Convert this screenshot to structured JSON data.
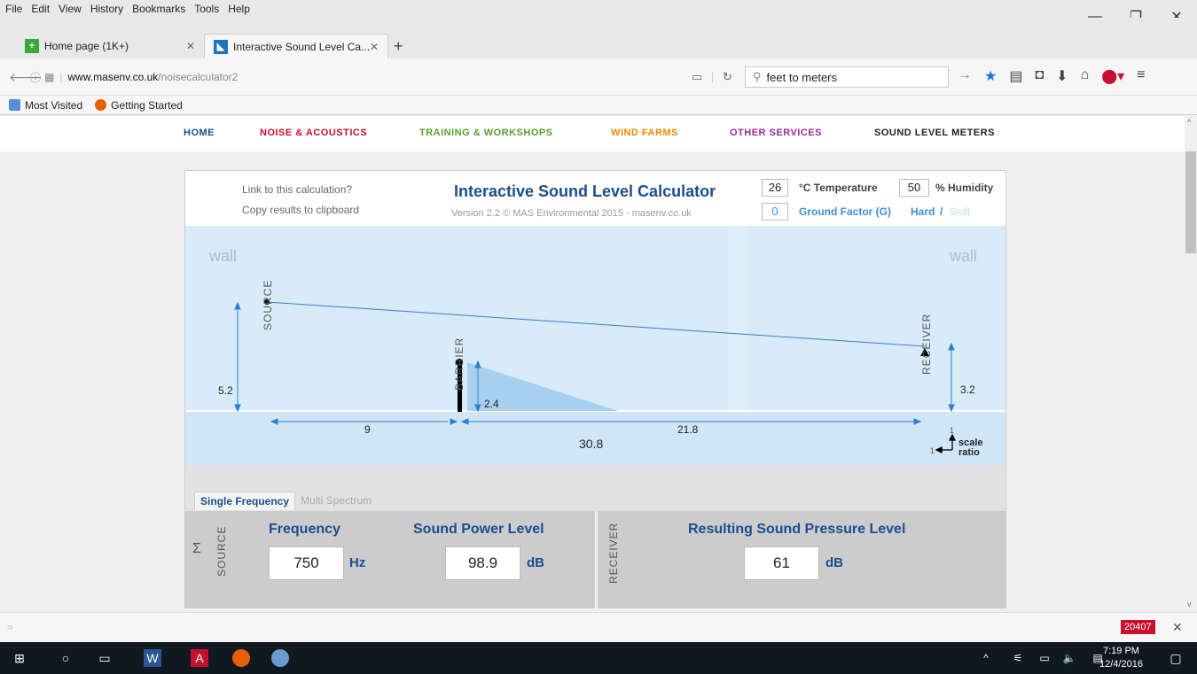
{
  "menubar": [
    "File",
    "Edit",
    "View",
    "History",
    "Bookmarks",
    "Tools",
    "Help"
  ],
  "tabs": [
    {
      "title": "Home page (1K+)",
      "active": false
    },
    {
      "title": "Interactive Sound Level Ca...",
      "active": true
    }
  ],
  "url": {
    "host": "www.masenv.co.uk",
    "path": "/noisecalculator2"
  },
  "search": {
    "value": "feet to meters"
  },
  "bookmarks": [
    "Most Visited",
    "Getting Started"
  ],
  "site_nav": [
    {
      "label": "HOME",
      "color": "#1a4e8e"
    },
    {
      "label": "NOISE & ACOUSTICS",
      "color": "#c8102e"
    },
    {
      "label": "TRAINING & WORKSHOPS",
      "color": "#5aa02c"
    },
    {
      "label": "WIND FARMS",
      "color": "#f08a00"
    },
    {
      "label": "OTHER SERVICES",
      "color": "#9b2d8e"
    },
    {
      "label": "SOUND LEVEL METERS",
      "color": "#222222"
    }
  ],
  "calculator": {
    "link_text": "Link to this calculation?",
    "copy_text": "Copy results to clipboard",
    "title": "Interactive Sound Level Calculator",
    "version": "Version 2.2 © MAS Environmental 2015 - masenv.co.uk",
    "temperature": "26",
    "temperature_label": "°C Temperature",
    "humidity": "50",
    "humidity_label": "% Humidity",
    "ground_factor": "0",
    "ground_label": "Ground Factor (G)",
    "hard": "Hard",
    "slash": "/",
    "soft": "Soft"
  },
  "diagram": {
    "wall_left": "wall",
    "wall_right": "wall",
    "source_label": "SOURCE",
    "barrier_label": "BARRIER",
    "receiver_label": "RECEIVER",
    "source_height": "5.2",
    "barrier_height": "2.4",
    "receiver_height": "3.2",
    "source_to_barrier": "9",
    "barrier_to_receiver": "21.8",
    "total_distance": "30.8",
    "scale_one_v": "1",
    "scale_one_h": "1",
    "scale": "scale",
    "ratio": "ratio"
  },
  "tabs_freq": {
    "single": "Single Frequency",
    "multi": "Multi Spectrum"
  },
  "panel": {
    "sigma": "Σ",
    "source_vlabel": "SOURCE",
    "receiver_vlabel": "RECEIVER",
    "frequency_title": "Frequency",
    "frequency_value": "750",
    "frequency_unit": "Hz",
    "power_title": "Sound Power Level",
    "power_value": "98.9",
    "power_unit": "dB",
    "result_title": "Resulting Sound Pressure Level",
    "result_value": "61",
    "result_unit": "dB"
  },
  "status": {
    "counter": "20407"
  },
  "taskbar": {
    "time": "7:19 PM",
    "date": "12/4/2016"
  }
}
